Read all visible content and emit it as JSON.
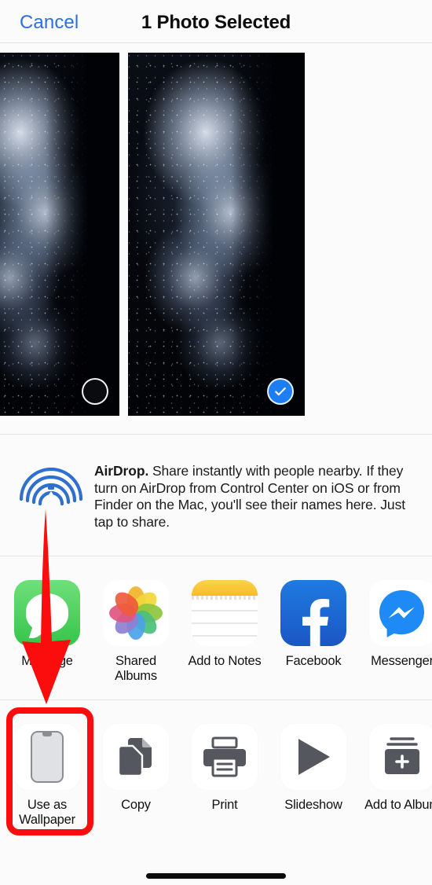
{
  "header": {
    "cancel_label": "Cancel",
    "title": "1 Photo Selected"
  },
  "photos": [
    {
      "name": "photo-thumbnail-1",
      "selected": false,
      "selection_icon": "empty-circle-icon"
    },
    {
      "name": "photo-thumbnail-2",
      "selected": true,
      "selection_icon": "checkmark-circle-icon"
    }
  ],
  "airdrop": {
    "icon": "airdrop-icon",
    "title": "AirDrop.",
    "description": " Share instantly with people nearby. If they turn on AirDrop from Control Center on iOS or from Finder on the Mac, you'll see their names here. Just tap to share."
  },
  "app_row": [
    {
      "label": "Message",
      "icon": "messages-app-icon"
    },
    {
      "label": "Shared\nAlbums",
      "label_line1": "Shared",
      "label_line2": "Albums",
      "icon": "photos-app-icon"
    },
    {
      "label": "Add to Notes",
      "icon": "notes-app-icon"
    },
    {
      "label": "Facebook",
      "icon": "facebook-app-icon"
    },
    {
      "label": "Messenger",
      "icon": "messenger-app-icon"
    }
  ],
  "action_row": [
    {
      "label_line1": "Use as",
      "label_line2": "Wallpaper",
      "icon": "iphone-wallpaper-icon",
      "highlighted": true
    },
    {
      "label_line1": "Copy",
      "label_line2": "",
      "icon": "copy-icon",
      "highlighted": false
    },
    {
      "label_line1": "Print",
      "label_line2": "",
      "icon": "printer-icon",
      "highlighted": false
    },
    {
      "label_line1": "Slideshow",
      "label_line2": "",
      "icon": "play-triangle-icon",
      "highlighted": false
    },
    {
      "label_line1": "Add to Album",
      "label_line2": "",
      "icon": "add-to-album-icon",
      "highlighted": false
    }
  ],
  "annotations": {
    "arrow": "red-down-arrow",
    "highlight_box": "red-highlight-box",
    "target": "Use as Wallpaper"
  },
  "colors": {
    "accent_blue": "#2e6ee0",
    "selection_blue": "#1d7df3",
    "annotation_red": "#fb0d0d",
    "background": "#fbfbfb",
    "divider": "#e4e4e4"
  },
  "home_indicator": "home-indicator-bar"
}
